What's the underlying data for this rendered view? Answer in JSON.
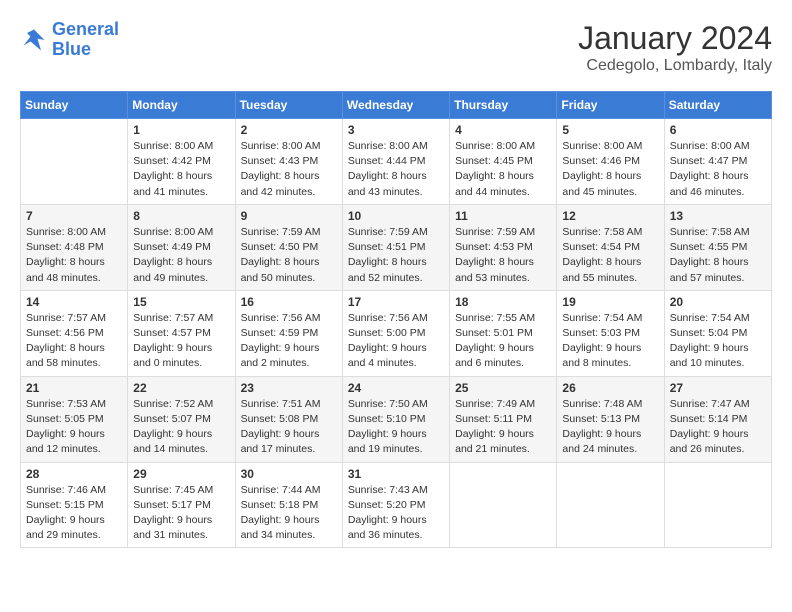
{
  "logo": {
    "line1": "General",
    "line2": "Blue"
  },
  "title": "January 2024",
  "location": "Cedegolo, Lombardy, Italy",
  "weekdays": [
    "Sunday",
    "Monday",
    "Tuesday",
    "Wednesday",
    "Thursday",
    "Friday",
    "Saturday"
  ],
  "weeks": [
    [
      {
        "day": "",
        "info": ""
      },
      {
        "day": "1",
        "info": "Sunrise: 8:00 AM\nSunset: 4:42 PM\nDaylight: 8 hours\nand 41 minutes."
      },
      {
        "day": "2",
        "info": "Sunrise: 8:00 AM\nSunset: 4:43 PM\nDaylight: 8 hours\nand 42 minutes."
      },
      {
        "day": "3",
        "info": "Sunrise: 8:00 AM\nSunset: 4:44 PM\nDaylight: 8 hours\nand 43 minutes."
      },
      {
        "day": "4",
        "info": "Sunrise: 8:00 AM\nSunset: 4:45 PM\nDaylight: 8 hours\nand 44 minutes."
      },
      {
        "day": "5",
        "info": "Sunrise: 8:00 AM\nSunset: 4:46 PM\nDaylight: 8 hours\nand 45 minutes."
      },
      {
        "day": "6",
        "info": "Sunrise: 8:00 AM\nSunset: 4:47 PM\nDaylight: 8 hours\nand 46 minutes."
      }
    ],
    [
      {
        "day": "7",
        "info": "Sunrise: 8:00 AM\nSunset: 4:48 PM\nDaylight: 8 hours\nand 48 minutes."
      },
      {
        "day": "8",
        "info": "Sunrise: 8:00 AM\nSunset: 4:49 PM\nDaylight: 8 hours\nand 49 minutes."
      },
      {
        "day": "9",
        "info": "Sunrise: 7:59 AM\nSunset: 4:50 PM\nDaylight: 8 hours\nand 50 minutes."
      },
      {
        "day": "10",
        "info": "Sunrise: 7:59 AM\nSunset: 4:51 PM\nDaylight: 8 hours\nand 52 minutes."
      },
      {
        "day": "11",
        "info": "Sunrise: 7:59 AM\nSunset: 4:53 PM\nDaylight: 8 hours\nand 53 minutes."
      },
      {
        "day": "12",
        "info": "Sunrise: 7:58 AM\nSunset: 4:54 PM\nDaylight: 8 hours\nand 55 minutes."
      },
      {
        "day": "13",
        "info": "Sunrise: 7:58 AM\nSunset: 4:55 PM\nDaylight: 8 hours\nand 57 minutes."
      }
    ],
    [
      {
        "day": "14",
        "info": "Sunrise: 7:57 AM\nSunset: 4:56 PM\nDaylight: 8 hours\nand 58 minutes."
      },
      {
        "day": "15",
        "info": "Sunrise: 7:57 AM\nSunset: 4:57 PM\nDaylight: 9 hours\nand 0 minutes."
      },
      {
        "day": "16",
        "info": "Sunrise: 7:56 AM\nSunset: 4:59 PM\nDaylight: 9 hours\nand 2 minutes."
      },
      {
        "day": "17",
        "info": "Sunrise: 7:56 AM\nSunset: 5:00 PM\nDaylight: 9 hours\nand 4 minutes."
      },
      {
        "day": "18",
        "info": "Sunrise: 7:55 AM\nSunset: 5:01 PM\nDaylight: 9 hours\nand 6 minutes."
      },
      {
        "day": "19",
        "info": "Sunrise: 7:54 AM\nSunset: 5:03 PM\nDaylight: 9 hours\nand 8 minutes."
      },
      {
        "day": "20",
        "info": "Sunrise: 7:54 AM\nSunset: 5:04 PM\nDaylight: 9 hours\nand 10 minutes."
      }
    ],
    [
      {
        "day": "21",
        "info": "Sunrise: 7:53 AM\nSunset: 5:05 PM\nDaylight: 9 hours\nand 12 minutes."
      },
      {
        "day": "22",
        "info": "Sunrise: 7:52 AM\nSunset: 5:07 PM\nDaylight: 9 hours\nand 14 minutes."
      },
      {
        "day": "23",
        "info": "Sunrise: 7:51 AM\nSunset: 5:08 PM\nDaylight: 9 hours\nand 17 minutes."
      },
      {
        "day": "24",
        "info": "Sunrise: 7:50 AM\nSunset: 5:10 PM\nDaylight: 9 hours\nand 19 minutes."
      },
      {
        "day": "25",
        "info": "Sunrise: 7:49 AM\nSunset: 5:11 PM\nDaylight: 9 hours\nand 21 minutes."
      },
      {
        "day": "26",
        "info": "Sunrise: 7:48 AM\nSunset: 5:13 PM\nDaylight: 9 hours\nand 24 minutes."
      },
      {
        "day": "27",
        "info": "Sunrise: 7:47 AM\nSunset: 5:14 PM\nDaylight: 9 hours\nand 26 minutes."
      }
    ],
    [
      {
        "day": "28",
        "info": "Sunrise: 7:46 AM\nSunset: 5:15 PM\nDaylight: 9 hours\nand 29 minutes."
      },
      {
        "day": "29",
        "info": "Sunrise: 7:45 AM\nSunset: 5:17 PM\nDaylight: 9 hours\nand 31 minutes."
      },
      {
        "day": "30",
        "info": "Sunrise: 7:44 AM\nSunset: 5:18 PM\nDaylight: 9 hours\nand 34 minutes."
      },
      {
        "day": "31",
        "info": "Sunrise: 7:43 AM\nSunset: 5:20 PM\nDaylight: 9 hours\nand 36 minutes."
      },
      {
        "day": "",
        "info": ""
      },
      {
        "day": "",
        "info": ""
      },
      {
        "day": "",
        "info": ""
      }
    ]
  ]
}
